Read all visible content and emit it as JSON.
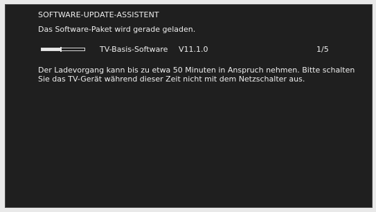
{
  "screen": {
    "title": "SOFTWARE-UPDATE-ASSISTENT",
    "subtitle": "Das Software-Paket wird gerade geladen.",
    "package": {
      "name": "TV-Basis-Software",
      "version": "V11.1.0",
      "counter": "1/5",
      "progress_fraction": 0.45
    },
    "message": "Der Ladevorgang kann bis zu etwa 50 Minuten in Anspruch nehmen. Bitte schalten Sie das TV-Gerät während dieser Zeit nicht mit dem Netzschalter aus."
  },
  "colors": {
    "screen_background": "#1f1f1f",
    "text": "#ececec",
    "outer_background": "#e9e9e9"
  }
}
